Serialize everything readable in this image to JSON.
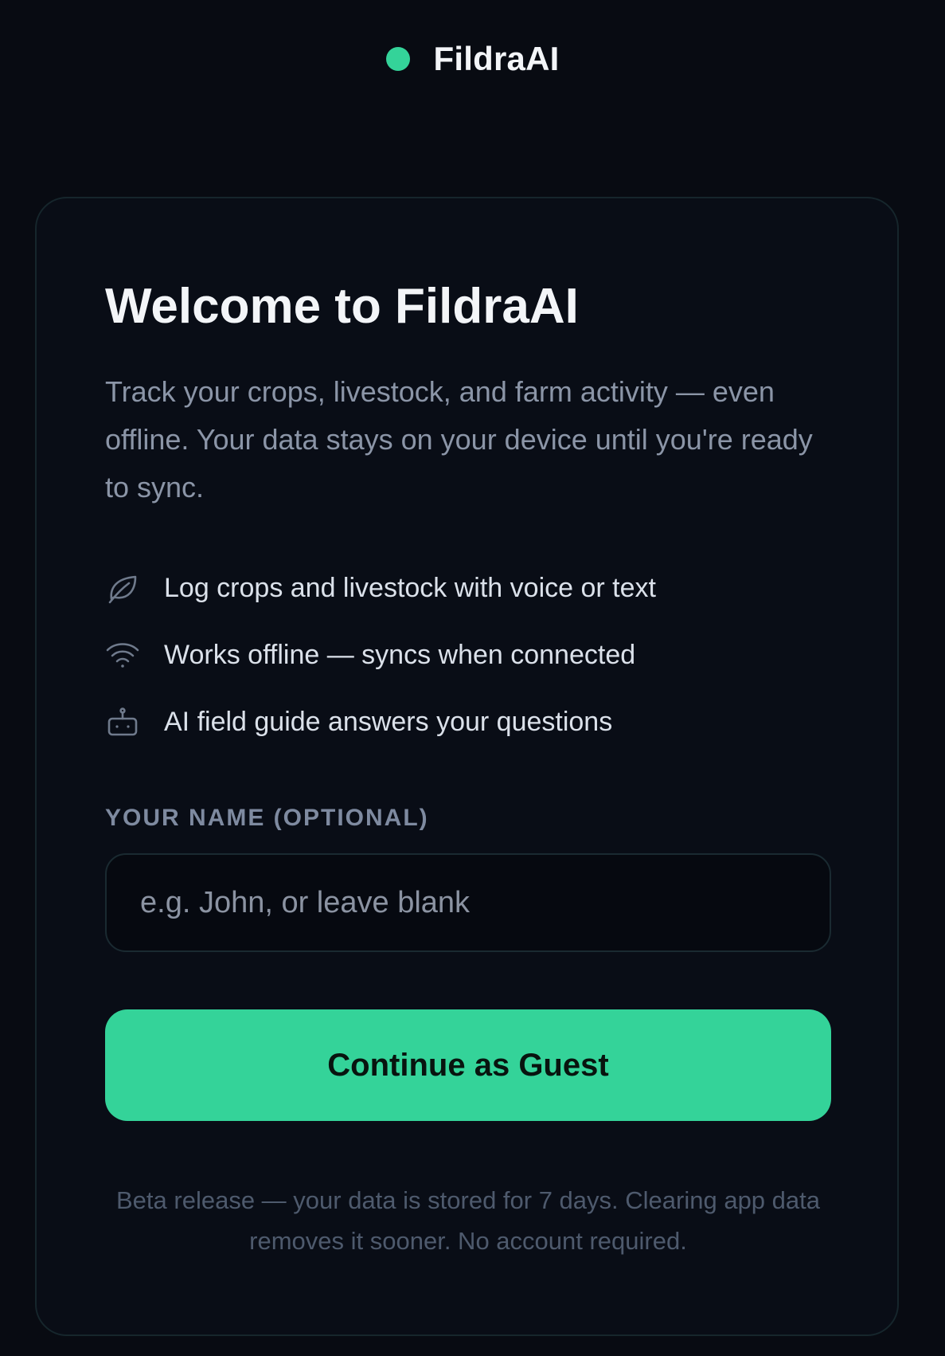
{
  "brand": {
    "name": "FildraAI",
    "dot_color": "#34d399"
  },
  "welcome": {
    "title": "Welcome to FildraAI",
    "subtitle": "Track your crops, livestock, and farm activity — even offline. Your data stays on your device until you're ready to sync."
  },
  "features": [
    {
      "icon": "leaf-icon",
      "text": "Log crops and livestock with voice or text"
    },
    {
      "icon": "wifi-icon",
      "text": "Works offline — syncs when connected"
    },
    {
      "icon": "robot-icon",
      "text": "AI field guide answers your questions"
    }
  ],
  "name_field": {
    "label": "YOUR NAME (OPTIONAL)",
    "placeholder": "e.g. John, or leave blank",
    "value": ""
  },
  "actions": {
    "continue_label": "Continue as Guest"
  },
  "footnote": "Beta release — your data is stored for 7 days. Clearing app data removes it sooner. No account required.",
  "colors": {
    "background": "#080b12",
    "accent": "#34d399"
  }
}
